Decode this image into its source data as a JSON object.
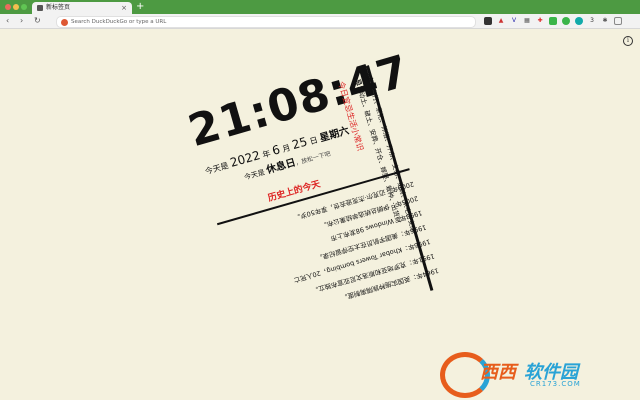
{
  "browser": {
    "tab_title": "新标签页",
    "tab_close": "×",
    "new_tab": "+",
    "address_placeholder": "Search DuckDuckGo or type a URL",
    "nav": {
      "back": "‹",
      "forward": "›",
      "reload": "↻"
    }
  },
  "colors": {
    "tabstrip": "#4d9a42",
    "accent": "#d22222",
    "background": "#f4f1de"
  },
  "extensions": [
    "shield",
    "triangle",
    "v",
    "grid",
    "star",
    "wechat",
    "wechat2",
    "dot",
    "num",
    "puzzle",
    "square"
  ],
  "clock": {
    "time": "21:08:47",
    "date_prefix": "今天是",
    "year": "2022",
    "year_unit": "年",
    "month": "6",
    "month_unit": "月",
    "day": "25",
    "day_unit": "日",
    "weekday": "星期六",
    "rest_prefix": "今天是",
    "rest_day": "休息日",
    "rest_suffix": "，放松一下吧"
  },
  "divider_title": "今日宜忌生活小常识",
  "history": {
    "title": "历史上的今天",
    "items": [
      "1964年：英国实施种族隔离制度。",
      "1991年：克罗地亚和斯洛文尼亚宣布独立。",
      "1996年：Khobar Towers bombing，20人死亡",
      "1996年：美国宇航员在太空停留纪录。",
      "1998年：Windows 98发布上市",
      "2005年：伊朗总统选举结果公布。",
      "2009年：迈克尔·杰克逊去世，享年50岁。"
    ]
  },
  "news": {
    "items": [
      {
        "label": "·宜：",
        "text": "出行、祭祀、沐浴、开市、交易、纳财、入宅、安床"
      },
      {
        "label": "·忌：",
        "text": "动土、破土、安葬、开仓、嫁娶、栽种、出货财"
      }
    ]
  },
  "watermark": {
    "brand1": "西西",
    "brand2": "软件园",
    "url": "CR173.COM"
  },
  "info_icon": "i"
}
